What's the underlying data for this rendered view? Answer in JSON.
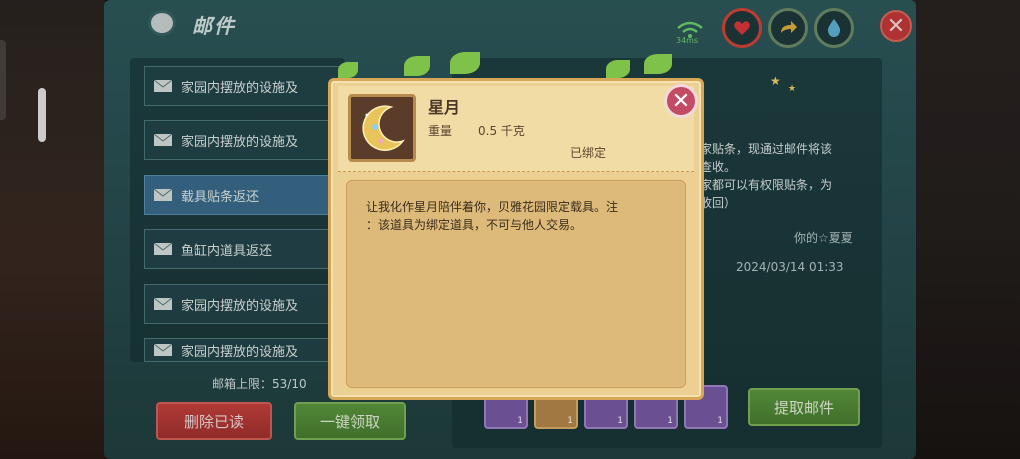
{
  "mail_window": {
    "title": "邮件",
    "wifi_text": "34ms",
    "mail_list": [
      {
        "label": "家园内摆放的设施及"
      },
      {
        "label": "家园内摆放的设施及"
      },
      {
        "label": "载具贴条返还"
      },
      {
        "label": "鱼缸内道具返还"
      },
      {
        "label": "家园内摆放的设施及"
      },
      {
        "label": "家园内摆放的设施及"
      }
    ],
    "mailbox_limit": "邮箱上限：53/10",
    "delete_read_label": "删除已读",
    "claim_all_label": "一键领取",
    "mail_body": [
      "家贴条，现通过邮件将该",
      "查收。",
      "家都可以有权限贴条，为",
      "收回）"
    ],
    "sender": "你的☆夏夏",
    "timestamp": "2024/03/14 01:33",
    "attachments": [
      {
        "qty": "1"
      },
      {
        "qty": "1"
      },
      {
        "qty": "1"
      },
      {
        "qty": "1"
      },
      {
        "qty": "1"
      }
    ],
    "collect_label": "提取邮件"
  },
  "item_popup": {
    "name": "星月",
    "weight_label": "重量",
    "weight_value": "0.5 千克",
    "bound_status": "已绑定",
    "description_lines": [
      "让我化作星月陪伴着你，贝雅花园限定载具。注",
      "：该道具为绑定道具，不可与他人交易。"
    ]
  },
  "colors": {
    "window_bg": "#2e5a5c",
    "popup_bg": "#eccf92",
    "delete_button": "#c8423e",
    "green_button": "#5d9a3e",
    "close_button": "#c44b66"
  },
  "icons": [
    "home-icon",
    "wifi-icon",
    "heart-icon",
    "share-icon",
    "drop-icon",
    "close-icon",
    "envelope-icon",
    "moon-item-icon"
  ]
}
